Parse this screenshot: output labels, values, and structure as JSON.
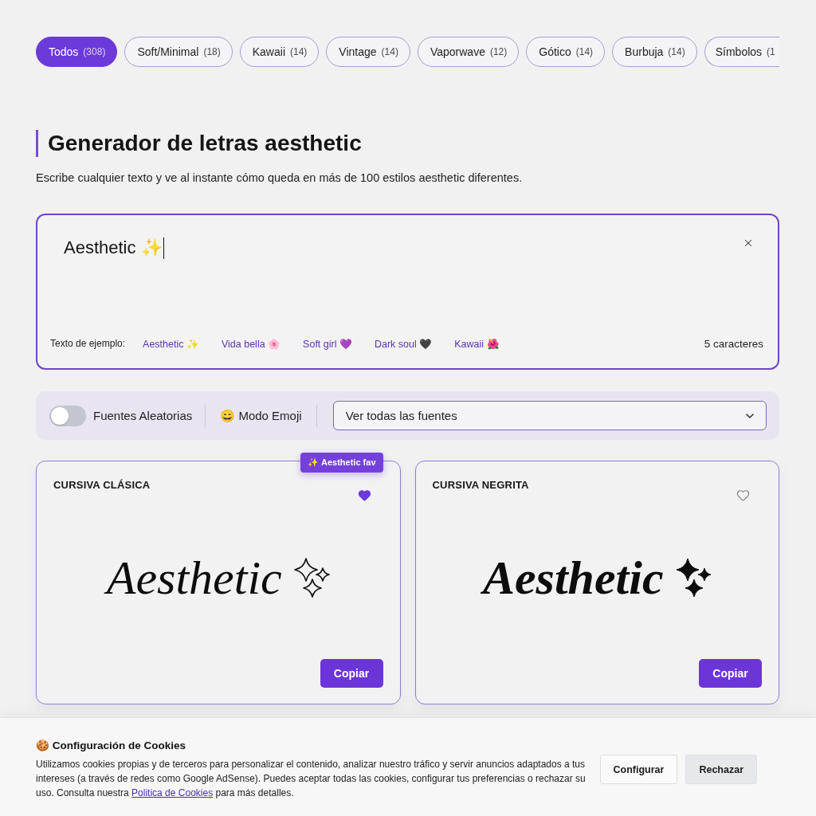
{
  "filters": [
    {
      "label": "Todos",
      "count": "(308)",
      "selected": true
    },
    {
      "label": "Soft/Minimal",
      "count": "(18)",
      "selected": false
    },
    {
      "label": "Kawaii",
      "count": "(14)",
      "selected": false
    },
    {
      "label": "Vintage",
      "count": "(14)",
      "selected": false
    },
    {
      "label": "Vaporwave",
      "count": "(12)",
      "selected": false
    },
    {
      "label": "Gótico",
      "count": "(14)",
      "selected": false
    },
    {
      "label": "Burbuja",
      "count": "(14)",
      "selected": false
    },
    {
      "label": "Símbolos",
      "count": "(1",
      "selected": false
    }
  ],
  "header": {
    "title": "Generador de letras aesthetic",
    "subtitle": "Escribe cualquier texto y ve al instante cómo queda en más de 100 estilos aesthetic diferentes."
  },
  "editor": {
    "value": "Aesthetic ✨",
    "examples_label": "Texto de ejemplo:",
    "examples": [
      "Aesthetic ✨",
      "Vida bella 🌸",
      "Soft girl 💜",
      "Dark soul 🖤",
      "Kawaii 🌺"
    ],
    "char_count": "5 caracteres"
  },
  "controls": {
    "random_fonts": {
      "label": "Fuentes Aleatorias",
      "on": false
    },
    "emoji_mode": {
      "label": "😄 Modo Emoji"
    },
    "font_select": {
      "value": "Ver todas las fuentes"
    }
  },
  "cards": [
    {
      "title": "CURSIVA CLÁSICA",
      "badge": "✨ Aesthetic fav",
      "favorite": true,
      "kind": "script",
      "preview": "Aesthetic",
      "button": "Copiar"
    },
    {
      "title": "CURSIVA NEGRITA",
      "favorite": false,
      "kind": "bold-script",
      "preview": "Aesthetic",
      "button": "Copiar"
    }
  ],
  "cookie_banner": {
    "title": "🍪 Configuración de Cookies",
    "text": "Utilizamos cookies propias y de terceros para personalizar el contenido, analizar nuestro tráfico y servir anuncios adaptados a tus intereses (a través de redes como Google AdSense). Puedes aceptar todas las cookies, configurar tus preferencias o rechazar su uso. Consulta nuestra",
    "link": "Politica de Cookies",
    "text_end": "para más detalles.",
    "buttons": [
      "Configurar",
      "Rechazar"
    ]
  }
}
